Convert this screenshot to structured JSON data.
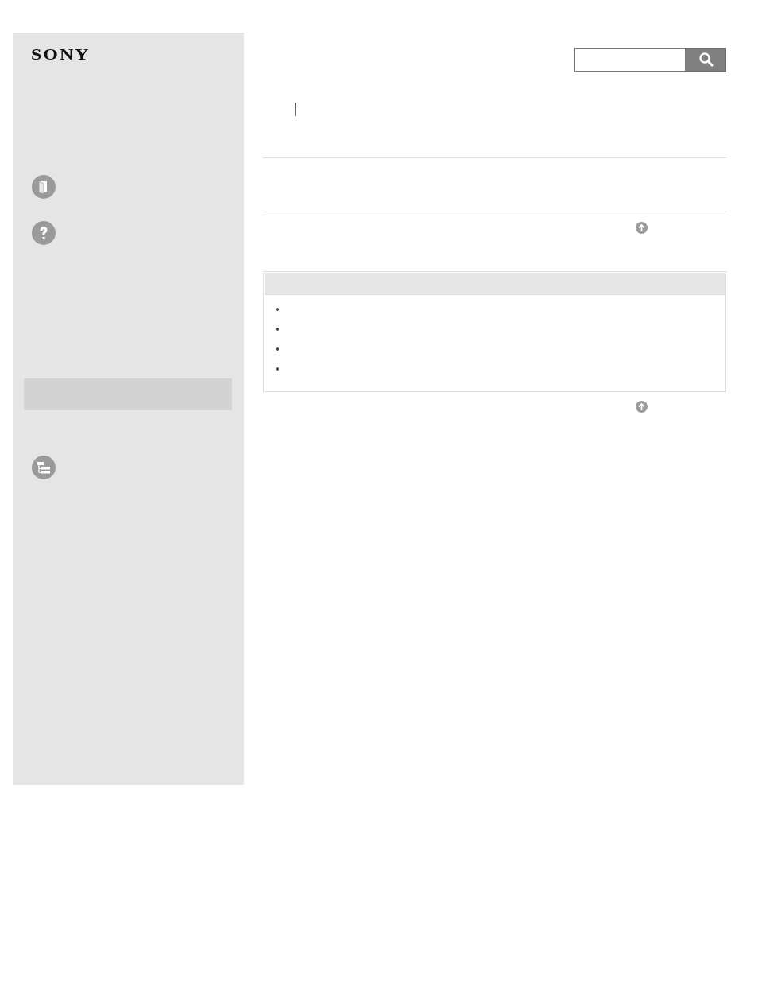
{
  "logo": "SONY",
  "sidebar": {
    "items": [
      {
        "kind": "book"
      },
      {
        "kind": "help"
      },
      {
        "kind": "highlight"
      },
      {
        "kind": "tree"
      }
    ]
  },
  "search": {
    "button": {
      "kind": "search"
    }
  },
  "main": {
    "sections": [
      {
        "kind": "breadcrumb"
      },
      {
        "kind": "rule"
      },
      {
        "kind": "rule"
      },
      {
        "kind": "top-link"
      },
      {
        "kind": "note-box",
        "items": [
          {
            "kind": "bullet"
          },
          {
            "kind": "bullet"
          },
          {
            "kind": "bullet"
          },
          {
            "kind": "bullet"
          }
        ]
      },
      {
        "kind": "top-link"
      }
    ]
  }
}
